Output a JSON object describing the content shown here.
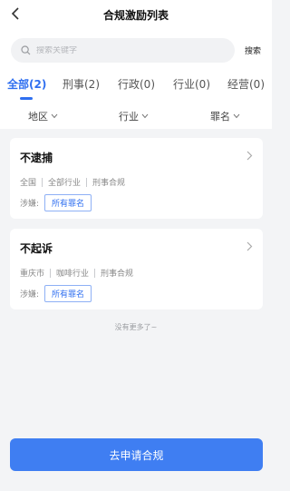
{
  "header": {
    "title": "合规激励列表",
    "back_icon": "chevron-left-icon"
  },
  "search": {
    "placeholder": "搜索关键字",
    "button_label": "搜索",
    "icon": "search-icon"
  },
  "tabs": [
    {
      "label": "全部(2)",
      "active": true
    },
    {
      "label": "刑事(2)",
      "active": false
    },
    {
      "label": "行政(0)",
      "active": false
    },
    {
      "label": "行业(0)",
      "active": false
    },
    {
      "label": "经营(0)",
      "active": false
    }
  ],
  "filters": [
    {
      "label": "地区"
    },
    {
      "label": "行业"
    },
    {
      "label": "罪名"
    }
  ],
  "items": [
    {
      "title": "不逮捕",
      "meta": [
        "全国",
        "全部行业",
        "刑事合规"
      ],
      "involve_label": "涉嫌:",
      "crime_tag": "所有罪名"
    },
    {
      "title": "不起诉",
      "meta": [
        "重庆市",
        "咖啡行业",
        "刑事合规"
      ],
      "involve_label": "涉嫌:",
      "crime_tag": "所有罪名"
    }
  ],
  "no_more_text": "没有更多了~",
  "apply_button_label": "去申请合规",
  "colors": {
    "accent": "#2f6ff0",
    "button": "#3f7ef2",
    "background": "#f3f4f6"
  }
}
